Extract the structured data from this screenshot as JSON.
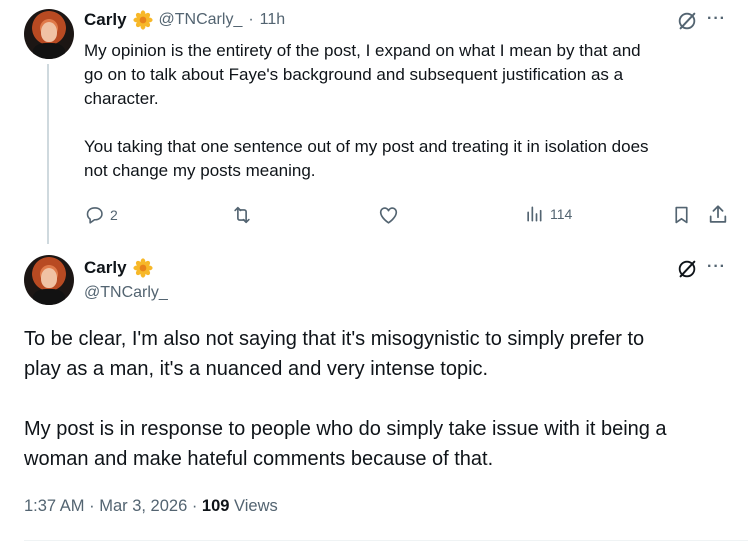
{
  "reply": {
    "author_name": "Carly",
    "handle": "@TNCarly_",
    "time_sep": "·",
    "time": "11h",
    "more": "···",
    "text": "My opinion is the entirety of the post, I expand on what I mean by that and\ngo on to talk about Faye's background and subsequent justification as a\ncharacter.\n\nYou taking that one sentence out of my post and treating it in isolation does\nnot change my posts meaning.",
    "replies_count": "2",
    "views_count": "114"
  },
  "main": {
    "author_name": "Carly",
    "handle": "@TNCarly_",
    "more": "···",
    "text": "To be clear, I'm also not saying that it's misogynistic to simply prefer to\nplay as a man, it's a nuanced and very intense topic.\n\nMy post is in response to people who do simply take issue with it being a\nwoman and make hateful comments because of that.",
    "timestamp": "1:37 AM · Mar 3, 2026 · ",
    "views_number": "109",
    "views_label": " Views"
  },
  "icons": {
    "verified": "flower-badge-icon",
    "grok": "grok-icon",
    "more": "more-icon",
    "reply": "reply-icon",
    "retweet": "retweet-icon",
    "like": "like-icon",
    "views": "views-icon",
    "bookmark": "bookmark-icon",
    "share": "share-icon"
  },
  "colors": {
    "text": "#0f1419",
    "secondary": "#536471",
    "flower_petal": "#f7b829",
    "flower_center": "#e8831a",
    "thread_line": "#cfd9de"
  }
}
